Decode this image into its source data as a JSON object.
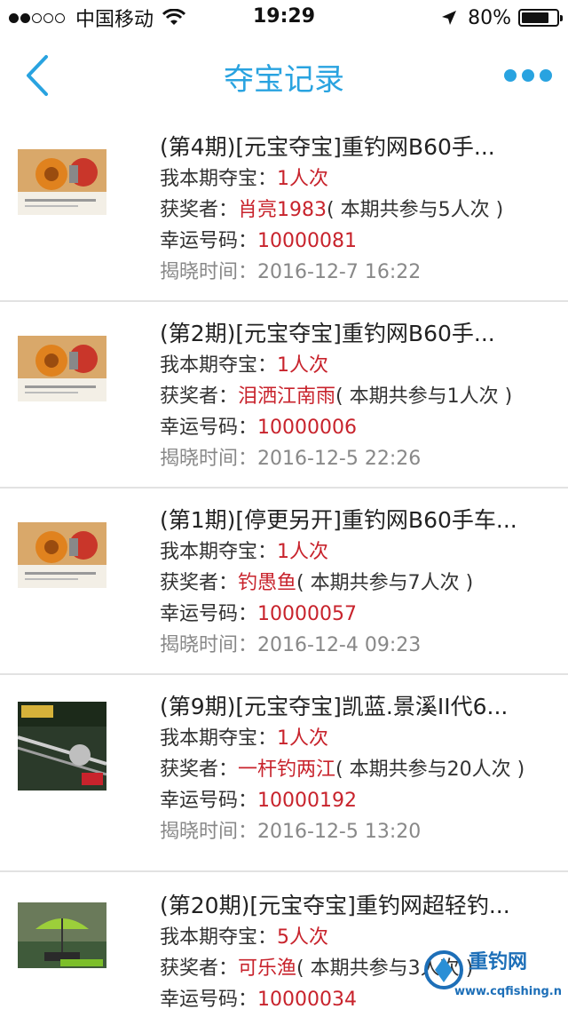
{
  "status_bar": {
    "carrier": "中国移动",
    "time": "19:29",
    "battery": "80%",
    "battery_level": 0.8
  },
  "nav": {
    "title": "夺宝记录"
  },
  "labels": {
    "my_entries": "我本期夺宝：",
    "winner": "获奖者：",
    "lucky_number": "幸运号码：",
    "reveal_time": "揭晓时间："
  },
  "records": [
    {
      "title": "(第4期)[元宝夺宝]重钓网B60手...",
      "my_entries": "1人次",
      "winner": "肖亮1983",
      "participation": "( 本期共参与5人次 )",
      "lucky_number": "10000081",
      "reveal_time": "2016-12-7 16:22"
    },
    {
      "title": "(第2期)[元宝夺宝]重钓网B60手...",
      "my_entries": "1人次",
      "winner": "泪洒江南雨",
      "participation": "( 本期共参与1人次 )",
      "lucky_number": "10000006",
      "reveal_time": "2016-12-5 22:26"
    },
    {
      "title": "(第1期)[停更另开]重钓网B60手车...",
      "my_entries": "1人次",
      "winner": "钓愚鱼",
      "participation": "( 本期共参与7人次 )",
      "lucky_number": "10000057",
      "reveal_time": "2016-12-4 09:23"
    },
    {
      "title": "(第9期)[元宝夺宝]凯蓝.景溪II代6...",
      "my_entries": "1人次",
      "winner": "一杆钓两江",
      "participation": "( 本期共参与20人次 )",
      "lucky_number": "10000192",
      "reveal_time": "2016-12-5 13:20"
    },
    {
      "title": "(第20期)[元宝夺宝]重钓网超轻钓...",
      "my_entries": "5人次",
      "winner": "可乐渔",
      "participation": "( 本期共参与3人次 )",
      "lucky_number": "10000034"
    }
  ],
  "watermark": {
    "brand": "重钓网",
    "url": "www.cqfishing.net"
  },
  "colors": {
    "accent": "#29a3e0",
    "highlight": "#c8232c",
    "muted": "#888888"
  }
}
